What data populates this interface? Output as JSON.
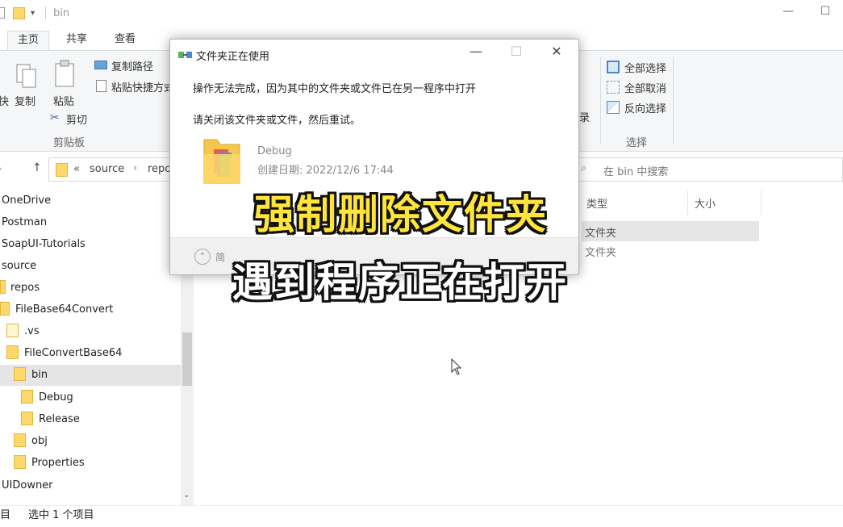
{
  "window": {
    "title": "bin",
    "controls": {
      "minimize": "—",
      "maximize": "☐"
    }
  },
  "ribbon": {
    "tabs": [
      {
        "label": "主页",
        "active": true
      },
      {
        "label": "共享",
        "active": false
      },
      {
        "label": "查看",
        "active": false
      }
    ],
    "clipboard": {
      "pin_partial": "快",
      "copy": "复制",
      "paste": "粘贴",
      "copy_path": "复制路径",
      "paste_shortcut": "粘贴快捷方式",
      "cut": "剪切",
      "group_label": "剪贴板"
    },
    "open_partial": "录",
    "select": {
      "select_all": "全部选择",
      "select_none": "全部取消",
      "invert": "反向选择",
      "group_label": "选择"
    }
  },
  "address": {
    "crumbs": [
      "source",
      "repo"
    ],
    "chevron": "«",
    "search_placeholder": "在 bin 中搜索"
  },
  "nav": {
    "items": [
      {
        "label": "OneDrive",
        "folder": false,
        "indent": 0,
        "selected": false
      },
      {
        "label": "Postman",
        "folder": false,
        "indent": 0,
        "selected": false
      },
      {
        "label": "SoapUI-Tutorials",
        "folder": false,
        "indent": 0,
        "selected": false
      },
      {
        "label": "source",
        "folder": false,
        "indent": 0,
        "selected": false
      },
      {
        "label": "repos",
        "folder": true,
        "indent": 0,
        "selected": false
      },
      {
        "label": "FileBase64Convert",
        "folder": true,
        "indent": 1,
        "selected": false
      },
      {
        "label": ".vs",
        "folder": true,
        "indent": 2,
        "selected": false
      },
      {
        "label": "FileConvertBase64",
        "folder": true,
        "indent": 2,
        "selected": false
      },
      {
        "label": "bin",
        "folder": true,
        "indent": 3,
        "selected": true
      },
      {
        "label": "Debug",
        "folder": true,
        "indent": 4,
        "selected": false
      },
      {
        "label": "Release",
        "folder": true,
        "indent": 4,
        "selected": false
      },
      {
        "label": "obj",
        "folder": true,
        "indent": 3,
        "selected": false
      },
      {
        "label": "Properties",
        "folder": true,
        "indent": 3,
        "selected": false
      },
      {
        "label": "UIDowner",
        "folder": false,
        "indent": 0,
        "selected": false
      }
    ]
  },
  "content": {
    "columns": [
      "类型",
      "大小"
    ],
    "rows": [
      {
        "type": "文件夹"
      },
      {
        "type": "文件夹"
      }
    ]
  },
  "status": {
    "count_partial": "目",
    "selection": "选中 1 个项目"
  },
  "dialog": {
    "title": "文件夹正在使用",
    "line1": "操作无法完成，因为其中的文件夹或文件已在另一程序中打开",
    "line2": "请关闭该文件夹或文件，然后重试。",
    "file_name": "Debug",
    "file_date": "创建日期: 2022/12/6 17:44",
    "details_label": "简"
  },
  "captions": {
    "line1": "强制删除文件夹",
    "line2": "遇到程序正在打开"
  },
  "colors": {
    "caption_yellow": "#ffe53b",
    "caption_white": "#ffffff",
    "folder": "#ffd86b",
    "accent": "#1979ca"
  }
}
